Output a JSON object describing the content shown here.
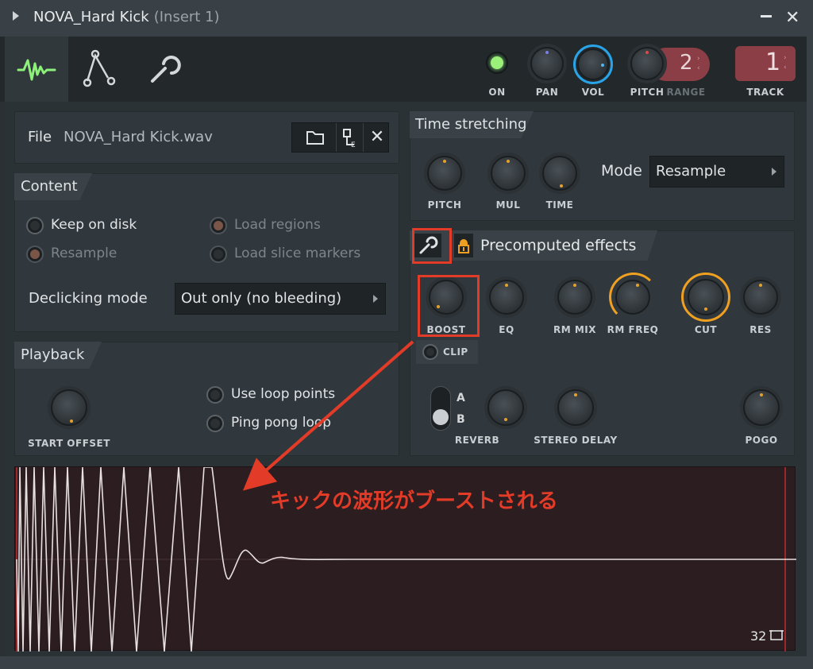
{
  "window": {
    "title": "NOVA_Hard Kick",
    "subtitle": "(Insert 1)"
  },
  "toolbar": {
    "on_label": "ON",
    "pan_label": "PAN",
    "vol_label": "VOL",
    "pitch_label": "PITCH",
    "range_label": "RANGE",
    "range_value": "2",
    "track_label": "TRACK",
    "track_value": "1"
  },
  "file": {
    "label": "File",
    "name": "NOVA_Hard Kick.wav"
  },
  "content": {
    "title": "Content",
    "keep_on_disk": "Keep on disk",
    "resample": "Resample",
    "load_regions": "Load regions",
    "load_slice_markers": "Load slice markers",
    "declicking_label": "Declicking mode",
    "declicking_value": "Out only (no bleeding)"
  },
  "playback": {
    "title": "Playback",
    "start_offset": "START OFFSET",
    "use_loop_points": "Use loop points",
    "ping_pong_loop": "Ping pong loop"
  },
  "time_stretching": {
    "title": "Time stretching",
    "pitch": "PITCH",
    "mul": "MUL",
    "time": "TIME",
    "mode_label": "Mode",
    "mode_value": "Resample"
  },
  "effects": {
    "title": "Precomputed effects",
    "boost": "BOOST",
    "eq": "EQ",
    "rm_mix": "RM MIX",
    "rm_freq": "RM FREQ",
    "cut": "CUT",
    "res": "RES",
    "clip": "CLIP",
    "a": "A",
    "b": "B",
    "reverb": "REVERB",
    "stereo_delay": "STEREO DELAY",
    "pogo": "POGO"
  },
  "annotation": {
    "text": "キックの波形がブーストされる",
    "color": "#e23b27"
  },
  "waveform": {
    "zoom_value": "32"
  },
  "colors": {
    "accent_green": "#8df07a",
    "accent_orange": "#f0a020",
    "accent_blue": "#2aa4e8",
    "annotation_red": "#e23b27"
  }
}
